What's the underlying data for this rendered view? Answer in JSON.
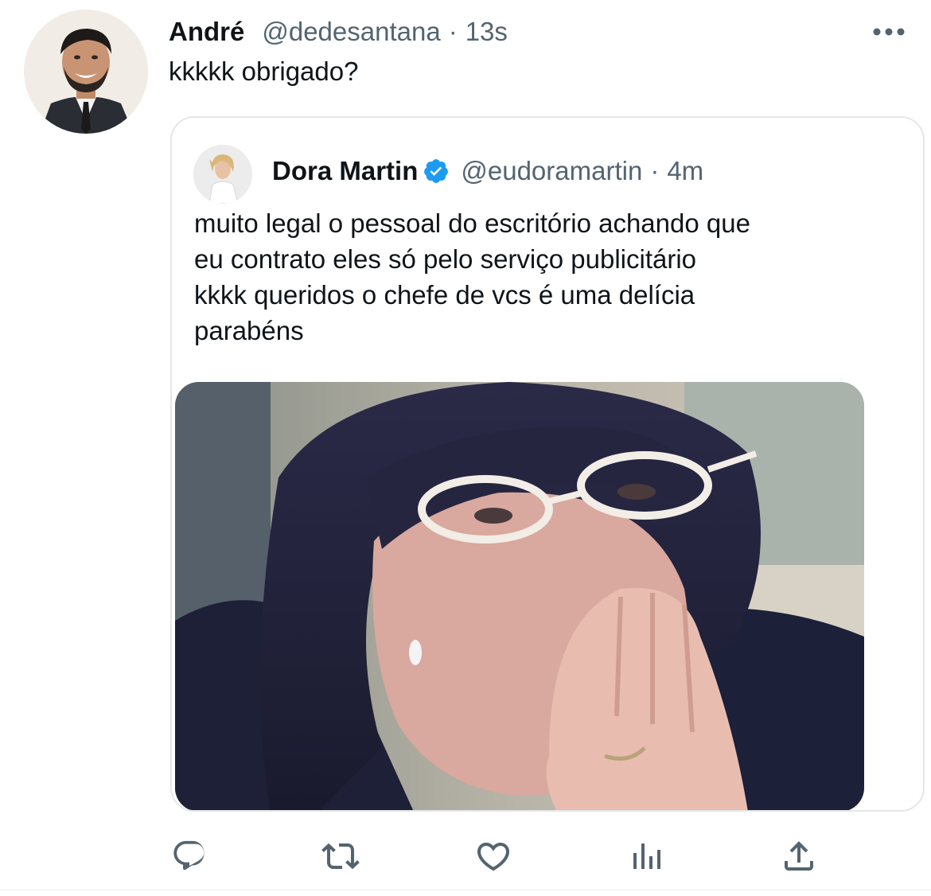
{
  "tweet": {
    "author_name": "André",
    "author_handle": "@dedesantana",
    "separator": "·",
    "time": "13s",
    "text": "kkkkk obrigado?"
  },
  "quoted_tweet": {
    "author_name": "Dora Martin",
    "verified": true,
    "author_handle": "@eudoramartin",
    "separator": "·",
    "time": "4m",
    "text_lines": [
      "muito legal o pessoal do escritório achando que",
      "eu contrato eles só pelo serviço publicitário",
      "kkkk queridos o chefe de vcs é uma delícia",
      "parabéns"
    ]
  },
  "actions": [
    "reply-icon",
    "retweet-icon",
    "like-icon",
    "analytics-icon",
    "share-icon"
  ],
  "colors": {
    "text": "#0f1419",
    "secondary": "#536471",
    "verified": "#1d9bf0",
    "border": "#e3e7ea",
    "icon": "#536471"
  }
}
